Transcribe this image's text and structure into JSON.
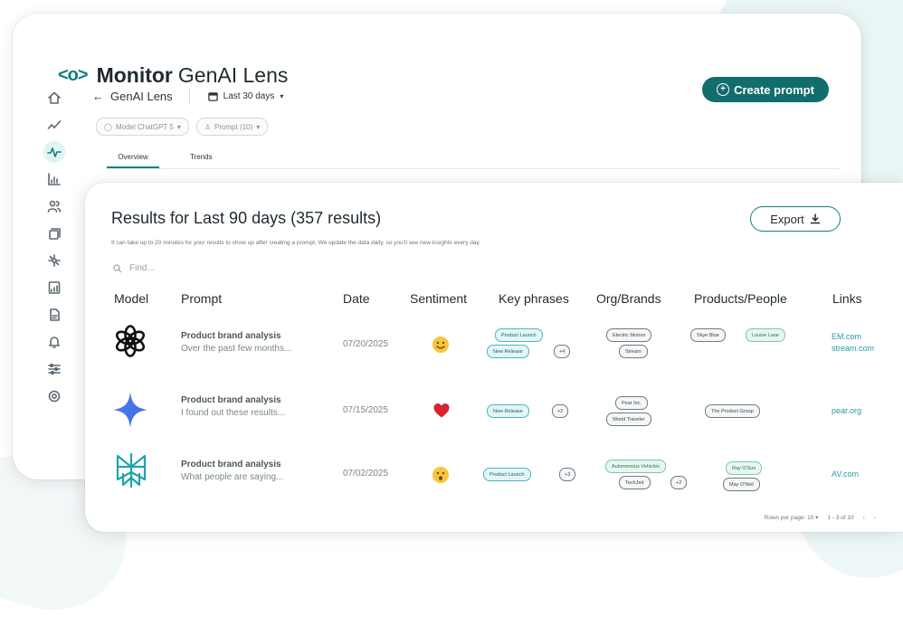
{
  "app": {
    "logo_mark": "<o>",
    "title_strong": "Monitor",
    "title_rest": "GenAI Lens",
    "create_prompt_label": "Create prompt"
  },
  "colors": {
    "brand": "#147f7f",
    "button": "#126d6d",
    "keyphrase": "#4fb6bd",
    "link": "#2b9aa3"
  },
  "nav_icons": [
    "home-icon",
    "trend-icon",
    "pulse-icon",
    "bar-chart-icon",
    "users-icon",
    "cards-icon",
    "network-icon",
    "report-icon",
    "file-icon",
    "bell-icon",
    "sliders-icon",
    "settings-icon"
  ],
  "header": {
    "back_arrow": "←",
    "breadcrumb": "GenAI Lens",
    "date_range": "Last 30 days"
  },
  "filters": [
    {
      "label": "Model ChatGPT 5",
      "icon": "model-icon"
    },
    {
      "label": "Prompt (10)",
      "icon": "prompt-icon"
    }
  ],
  "tabs": [
    {
      "label": "Overview",
      "active": true
    },
    {
      "label": "Trends",
      "active": false
    }
  ],
  "results": {
    "title": "Results for Last 90 days (357 results)",
    "subtitle": "It can take up to 20 minutes for your results to show up after creating a prompt. We update the data daily, so you'll see new insights every day.",
    "export_label": "Export",
    "search_placeholder": "Find..."
  },
  "table": {
    "columns": [
      "Model",
      "Prompt",
      "Date",
      "Sentiment",
      "Key phrases",
      "Org/Brands",
      "Products/People",
      "Links"
    ],
    "rows": [
      {
        "model": "openai-icon",
        "prompt_title": "Product brand analysis",
        "prompt_sub": "Over the past few months...",
        "date": "07/20/2025",
        "sentiment": "smile-emoji",
        "key_phrases": [
          "Product Launch",
          "New Release",
          "+4"
        ],
        "orgs": [
          "Electric Motors",
          "Stream"
        ],
        "products": [
          "Skye Blue",
          "Louise Lane"
        ],
        "links": [
          "EM.com",
          "stream.com"
        ]
      },
      {
        "model": "gemini-icon",
        "prompt_title": "Product brand analysis",
        "prompt_sub": "I found out these results...",
        "date": "07/15/2025",
        "sentiment": "heart-emoji",
        "key_phrases": [
          "New Release",
          "+2"
        ],
        "orgs": [
          "Pear Inc.",
          "World Traveler"
        ],
        "products": [
          "The Product Group"
        ],
        "links": [
          "pear.org"
        ]
      },
      {
        "model": "perplexity-icon",
        "prompt_title": "Product brand analysis",
        "prompt_sub": "What people are saying...",
        "date": "07/02/2025",
        "sentiment": "surprised-emoji",
        "key_phrases": [
          "Product Launch",
          "+3"
        ],
        "orgs": [
          "Autonomous Vehicles",
          "TechJed",
          "+2"
        ],
        "products": [
          "Ray O'Sun",
          "May O'Neil"
        ],
        "links": [
          "AV.com"
        ]
      }
    ]
  },
  "pagination": {
    "rows_per_page": "Rows per page: 10",
    "range": "1 - 3 of 10"
  }
}
